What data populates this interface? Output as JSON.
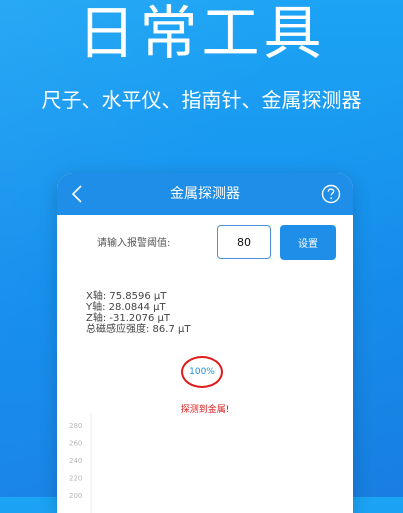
{
  "hero": {
    "title": "日常工具",
    "subtitle": "尺子、水平仪、指南针、金属探测器"
  },
  "app": {
    "header_title": "金属探测器",
    "back_icon": "chevron-left-icon",
    "help_icon": "question-circle-icon",
    "threshold_label": "请输入报警阈值:",
    "threshold_value": "80",
    "set_button_label": "设置",
    "readings": [
      "X轴:  75.8596 μT",
      "Y轴:  28.0844 μT",
      "Z轴:  -31.2076 μT",
      "总磁感应强度:  86.7 μT"
    ],
    "percent": "100%",
    "alert": "探测到金属!"
  },
  "chart_data": {
    "type": "line",
    "y_ticks": [
      "280",
      "260",
      "240",
      "220",
      "200"
    ],
    "series": []
  },
  "colors": {
    "accent": "#1f8ee8",
    "alert": "#e01c1c",
    "background": "#1791ee"
  }
}
